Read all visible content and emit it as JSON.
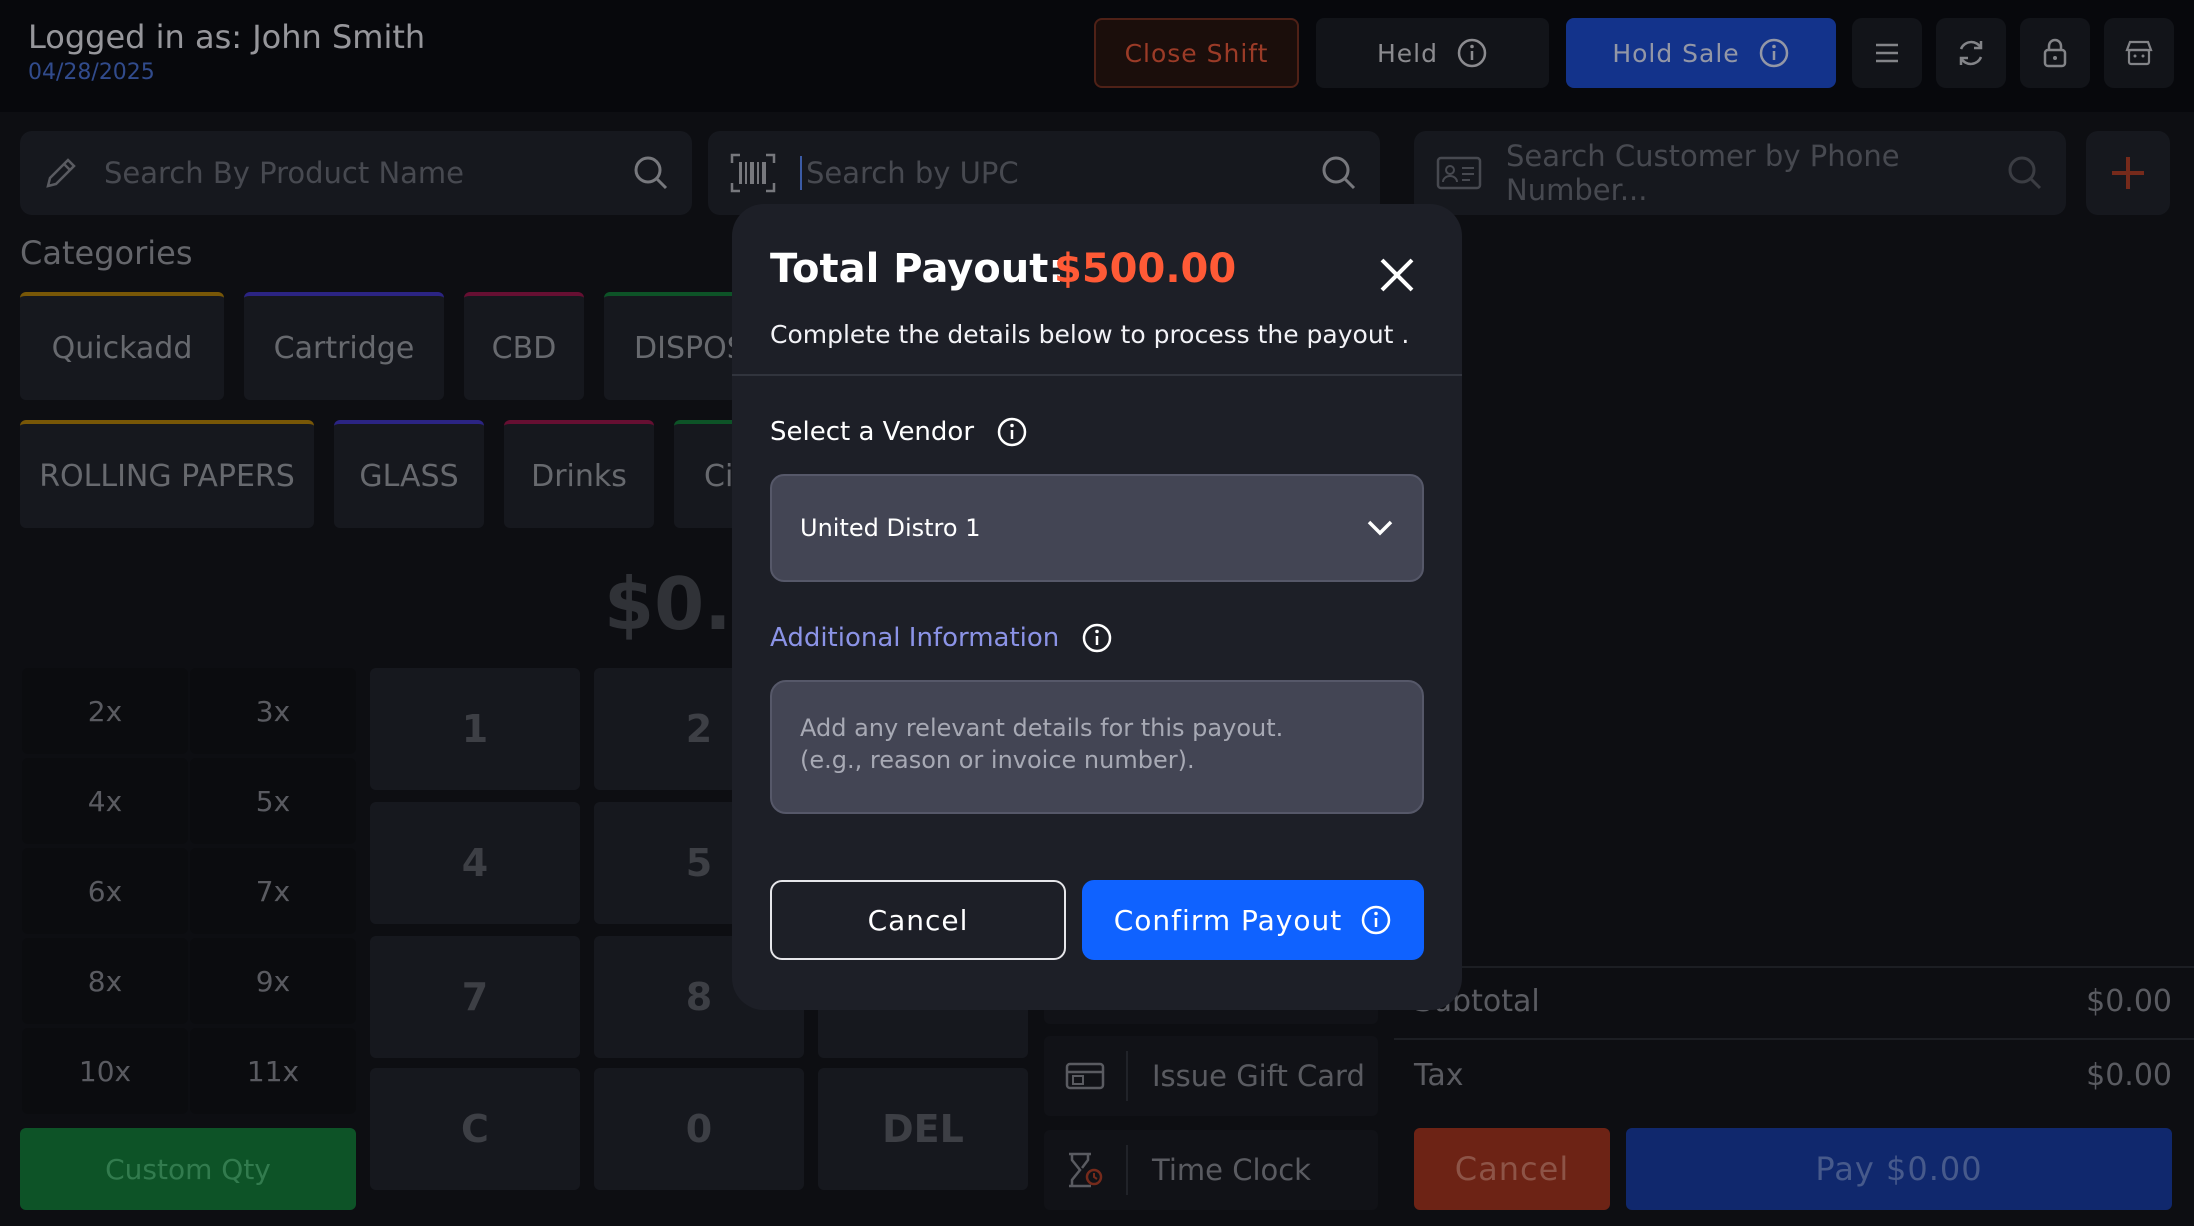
{
  "header": {
    "user": "Logged in as: John Smith",
    "date": "04/28/2025",
    "close_shift": "Close Shift",
    "held": "Held",
    "hold_sale": "Hold Sale"
  },
  "search": {
    "product_placeholder": "Search By Product Name",
    "upc_placeholder": "Search by UPC",
    "customer_placeholder": "Search Customer by Phone Number..."
  },
  "categories": {
    "heading": "Categories",
    "row1": [
      "Quickadd",
      "Cartridge",
      "CBD",
      "DISPOS"
    ],
    "row2": [
      "ROLLING PAPERS",
      "GLASS",
      "Drinks",
      "Ci"
    ]
  },
  "total_display": "$0.0",
  "qty_buttons": [
    "2x",
    "3x",
    "4x",
    "5x",
    "6x",
    "7x",
    "8x",
    "9x",
    "10x",
    "11x"
  ],
  "custom_qty": "Custom Qty",
  "keypad": [
    "1",
    "2",
    "4",
    "5",
    "7",
    "8",
    "C",
    "0",
    "DEL"
  ],
  "side_actions": {
    "issue_gift_card": "Issue Gift Card",
    "time_clock": "Time Clock"
  },
  "summary": {
    "subtotal_label": "Subtotal",
    "subtotal_value": "$0.00",
    "tax_label": "Tax",
    "tax_value": "$0.00",
    "cancel": "Cancel",
    "pay": "Pay $0.00"
  },
  "modal": {
    "title": "Total Payout:",
    "amount": "$500.00",
    "subtitle": "Complete the details below to process the payout .",
    "vendor_label": "Select a Vendor",
    "vendor_value": "United Distro 1",
    "info_label": "Additional Information",
    "info_placeholder": "Add any relevant details for this payout.\n (e.g., reason or invoice number).",
    "cancel": "Cancel",
    "confirm": "Confirm Payout"
  },
  "colors": {
    "accent_blue": "#0f62ff",
    "amount_orange": "#ff5a36",
    "info_label_color": "#8b93e6"
  }
}
